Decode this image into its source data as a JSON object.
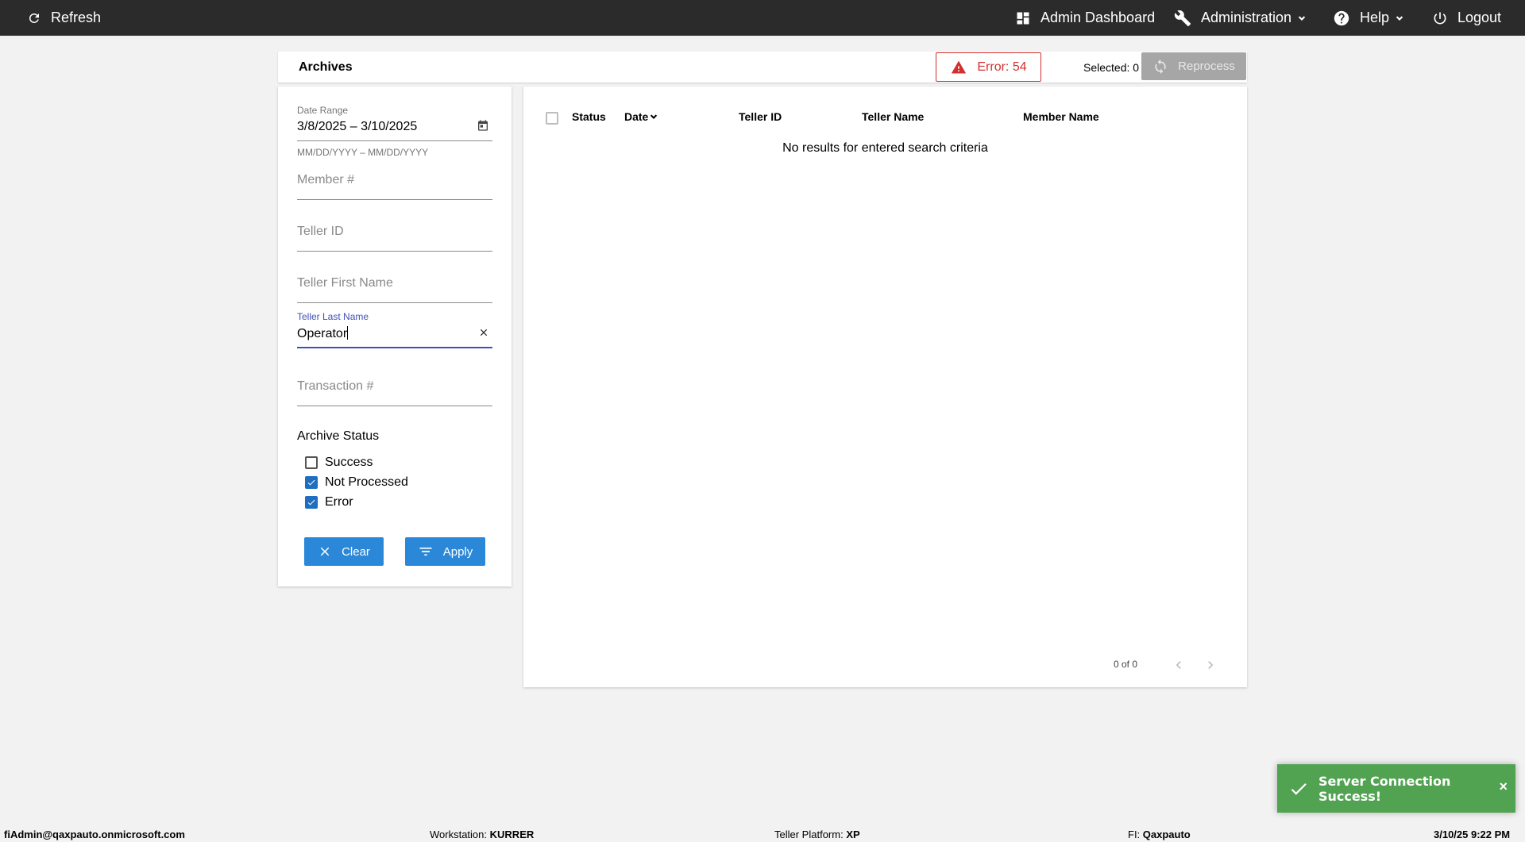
{
  "topbar": {
    "refresh_label": "Refresh",
    "admin_dashboard_label": "Admin Dashboard",
    "administration_label": "Administration",
    "help_label": "Help",
    "logout_label": "Logout"
  },
  "archives": {
    "title": "Archives",
    "error_label": "Error: 54",
    "selected_label": "Selected: 0",
    "reprocess_label": "Reprocess"
  },
  "filters": {
    "date_range_label": "Date Range",
    "date_range_value": "3/8/2025 – 3/10/2025",
    "date_range_hint": "MM/DD/YYYY – MM/DD/YYYY",
    "member_placeholder": "Member #",
    "teller_id_placeholder": "Teller ID",
    "teller_first_placeholder": "Teller First Name",
    "teller_last_label": "Teller Last Name",
    "teller_last_value": "Operator",
    "transaction_placeholder": "Transaction #",
    "archive_status_title": "Archive Status",
    "statuses": [
      {
        "label": "Success",
        "checked": false
      },
      {
        "label": "Not Processed",
        "checked": true
      },
      {
        "label": "Error",
        "checked": true
      }
    ],
    "clear_label": "Clear",
    "apply_label": "Apply"
  },
  "table": {
    "columns": [
      "Status",
      "Date",
      "Teller ID",
      "Teller Name",
      "Member Name"
    ],
    "no_results": "No results for entered search criteria",
    "pager": "0 of 0"
  },
  "toast": {
    "message": "Server Connection Success!",
    "close": "×"
  },
  "statusbar": {
    "user": "fiAdmin@qaxpauto.onmicrosoft.com",
    "workstation_label": "Workstation:",
    "workstation_value": "KURRER",
    "platform_label": "Teller Platform:",
    "platform_value": "XP",
    "fi_label": "FI:",
    "fi_value": "Qaxpauto",
    "datetime": "3/10/25 9:22 PM"
  },
  "colors": {
    "topbar": "#2b2b2b",
    "accent": "#2b88d8",
    "error": "#d32f2f",
    "toast": "#51a351",
    "focus": "#3f51b5"
  }
}
